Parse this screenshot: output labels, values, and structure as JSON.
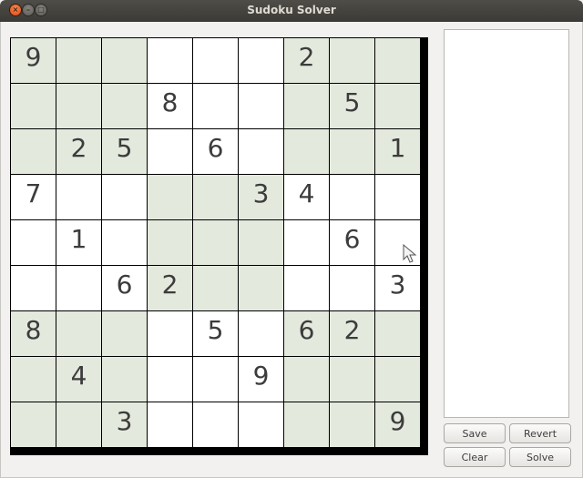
{
  "window": {
    "title": "Sudoku Solver",
    "close_glyph": "×",
    "minimize_glyph": "–",
    "maximize_glyph": "□"
  },
  "board": {
    "cells": [
      [
        "9",
        "",
        "",
        "",
        "",
        "",
        "2",
        "",
        ""
      ],
      [
        "",
        "",
        "",
        "8",
        "",
        "",
        "",
        "5",
        ""
      ],
      [
        "",
        "2",
        "5",
        "",
        "6",
        "",
        "",
        "",
        "1"
      ],
      [
        "7",
        "",
        "",
        "",
        "",
        "3",
        "4",
        "",
        ""
      ],
      [
        "",
        "1",
        "",
        "",
        "",
        "",
        "",
        "6",
        ""
      ],
      [
        "",
        "",
        "6",
        "2",
        "",
        "",
        "",
        "",
        "3"
      ],
      [
        "8",
        "",
        "",
        "",
        "5",
        "",
        "6",
        "2",
        ""
      ],
      [
        "",
        "4",
        "",
        "",
        "",
        "9",
        "",
        "",
        ""
      ],
      [
        "",
        "",
        "3",
        "",
        "",
        "",
        "",
        "",
        "9"
      ]
    ],
    "colors": {
      "shaded_box": "#e3e9dd",
      "plain_box": "#ffffff",
      "grid_line": "#000000",
      "digit": "#3c3c3c"
    }
  },
  "side_panel": {
    "text": ""
  },
  "buttons": {
    "save_label": "Save",
    "revert_label": "Revert",
    "clear_label": "Clear",
    "solve_label": "Solve"
  }
}
